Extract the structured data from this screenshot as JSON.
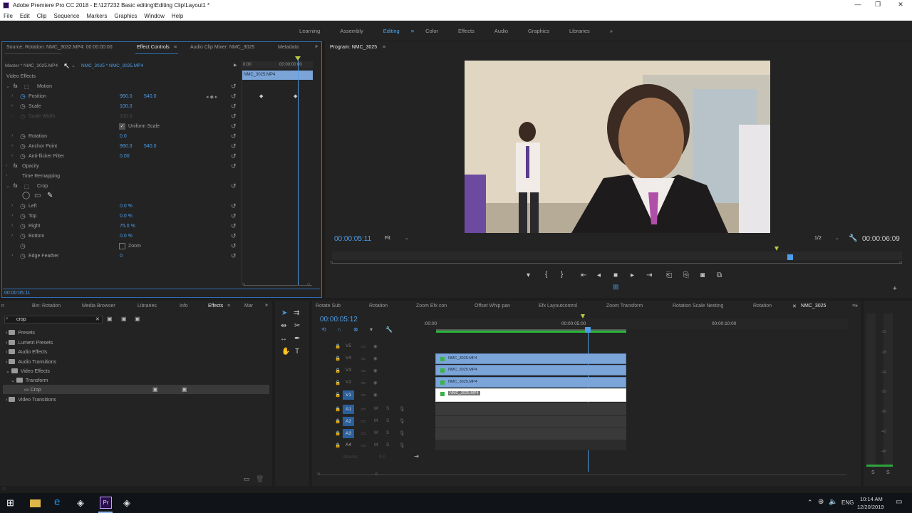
{
  "app": {
    "title": "Adobe Premiere Pro CC 2018 - E:\\127232 Basic editing\\Editing Clip\\Layout1 *",
    "window_controls": [
      "—",
      "❐",
      "✕"
    ]
  },
  "menu": [
    "File",
    "Edit",
    "Clip",
    "Sequence",
    "Markers",
    "Graphics",
    "Window",
    "Help"
  ],
  "workspaces": {
    "items": [
      "Learning",
      "Assembly",
      "Editing",
      "Color",
      "Effects",
      "Audio",
      "Graphics",
      "Libraries"
    ],
    "active": "Editing",
    "more": "»"
  },
  "effect_controls": {
    "tabs": [
      "Source: Rotation: NMC_3032.MP4: 00:00:00:00",
      "Effect Controls",
      "Audio Clip Mixer: NMC_3025",
      "Metadata"
    ],
    "master_label": "Master * NMC_3025.MP4",
    "clip_label": "NMC_3025 * NMC_3025.MP4",
    "ruler_start": "0:00",
    "ruler_end": "00:00:00:00",
    "mini_clip": "NMC_3025.MP4",
    "section": "Video Effects",
    "motion": "Motion",
    "position_label": "Position",
    "position_x": "960.0",
    "position_y": "540.0",
    "scale_label": "Scale",
    "scale_value": "100.0",
    "scale_width_label": "Scale Width",
    "scale_width_value": "100.0",
    "uniform_scale": "Uniform Scale",
    "rotation_label": "Rotation",
    "rotation_value": "0.0",
    "anchor_label": "Anchor Point",
    "anchor_x": "960.0",
    "anchor_y": "540.0",
    "antiflicker_label": "Anti-flicker Filter",
    "antiflicker_value": "0.00",
    "opacity": "Opacity",
    "time_remap": "Time Remapping",
    "crop": "Crop",
    "left_label": "Left",
    "left_value": "0.0 %",
    "top_label": "Top",
    "top_value": "0.0 %",
    "right_label": "Right",
    "right_value": "75.0 %",
    "bottom_label": "Bottom",
    "bottom_value": "0.0 %",
    "zoom_label": "Zoom",
    "edge_label": "Edge Feather",
    "edge_value": "0",
    "timecode": "00:00:05:11"
  },
  "program": {
    "title": "Program: NMC_3025",
    "timecode": "00:00:05:11",
    "fit": "Fit",
    "resolution": "1/2",
    "duration": "00:00:06:09"
  },
  "effects_panel": {
    "tabs": [
      "Bin: Rotation",
      "Media Browser",
      "Libraries",
      "Info",
      "Effects",
      "Mar"
    ],
    "more": "»",
    "search_value": "crop",
    "tree": [
      "Presets",
      "Lumetri Presets",
      "Audio Effects",
      "Audio Transitions",
      "Video Effects",
      "Transform",
      "Crop",
      "Video Transitions"
    ]
  },
  "timeline": {
    "tabs": [
      "Rotate Sub",
      "Rotation",
      "Zoom Efx con",
      "Offset Whip pan",
      "Efx Layoutcontrol",
      "Zoom Transform",
      "Rotation Scale Nesting",
      "Rotation",
      "NMC_3025"
    ],
    "active_tab": "NMC_3025",
    "timecode": "00:00:05:12",
    "ruler_labels": [
      ":00:00",
      "00:00:05:00",
      "00:00:10:00"
    ],
    "video_tracks": [
      "V5",
      "V4",
      "V3",
      "V2",
      "V1"
    ],
    "audio_tracks": [
      "A1",
      "A2",
      "A3",
      "A4"
    ],
    "master_label": "Master",
    "master_value": "0.0",
    "clip_name": "NMC_3025.MP4"
  },
  "meter": {
    "ticks": [
      "-12",
      "-18",
      "-24",
      "-30",
      "-36",
      "-42",
      "-48"
    ],
    "solo": [
      "S",
      "S"
    ]
  },
  "taskbar": {
    "lang": "ENG",
    "time": "10:14 AM",
    "date": "12/20/2019"
  },
  "colors": {
    "accent": "#4d9de8",
    "clip": "#7ba5d8",
    "playhead": "#4d9de8",
    "app_bg": "#232323"
  }
}
